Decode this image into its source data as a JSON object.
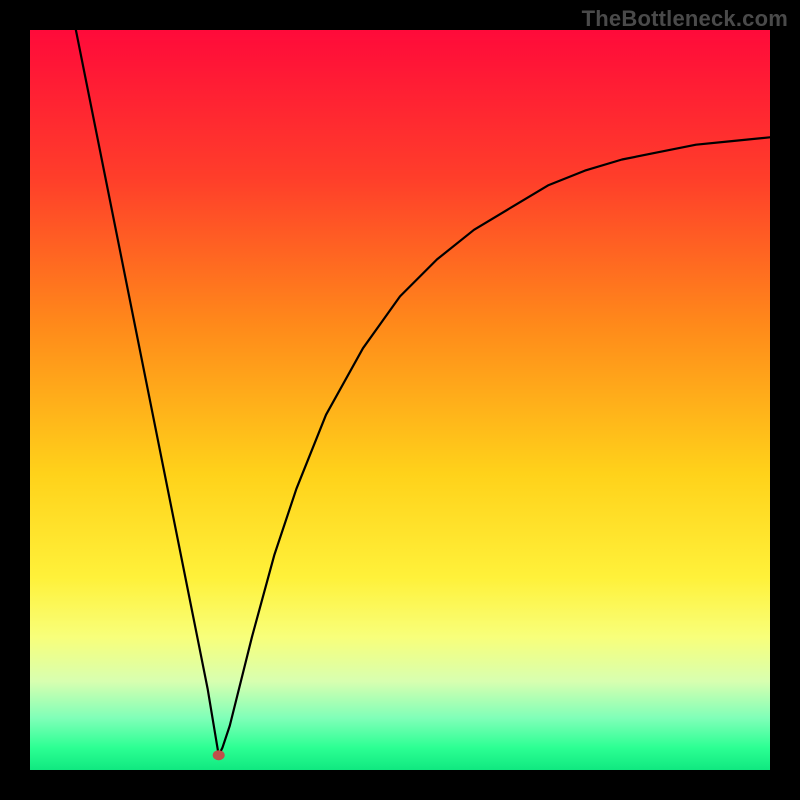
{
  "brand": "TheBottleneck.com",
  "chart_data": {
    "type": "line",
    "title": "",
    "xlabel": "",
    "ylabel": "",
    "xlim": [
      0,
      100
    ],
    "ylim": [
      0,
      100
    ],
    "grid": false,
    "legend": false,
    "gradient_stops": [
      {
        "offset": 0,
        "color": "#ff0a3a"
      },
      {
        "offset": 0.2,
        "color": "#ff3e2a"
      },
      {
        "offset": 0.4,
        "color": "#ff8a1a"
      },
      {
        "offset": 0.6,
        "color": "#ffd21a"
      },
      {
        "offset": 0.74,
        "color": "#fff13a"
      },
      {
        "offset": 0.82,
        "color": "#f8ff7a"
      },
      {
        "offset": 0.88,
        "color": "#d8ffb0"
      },
      {
        "offset": 0.93,
        "color": "#7fffb8"
      },
      {
        "offset": 0.97,
        "color": "#2cff93"
      },
      {
        "offset": 1.0,
        "color": "#10e880"
      }
    ],
    "marker": {
      "x": 25.5,
      "y": 2.0,
      "color": "#c0504a",
      "r": 5
    },
    "series": [
      {
        "name": "curve",
        "color": "#000000",
        "x": [
          6,
          10,
          14,
          18,
          22,
          24,
          25,
          25.5,
          26,
          27,
          28,
          30,
          33,
          36,
          40,
          45,
          50,
          55,
          60,
          65,
          70,
          75,
          80,
          85,
          90,
          95,
          100
        ],
        "y": [
          101,
          81,
          61,
          41,
          21,
          11,
          5,
          2,
          3,
          6,
          10,
          18,
          29,
          38,
          48,
          57,
          64,
          69,
          73,
          76,
          79,
          81,
          82.5,
          83.5,
          84.5,
          85,
          85.5
        ]
      }
    ]
  }
}
